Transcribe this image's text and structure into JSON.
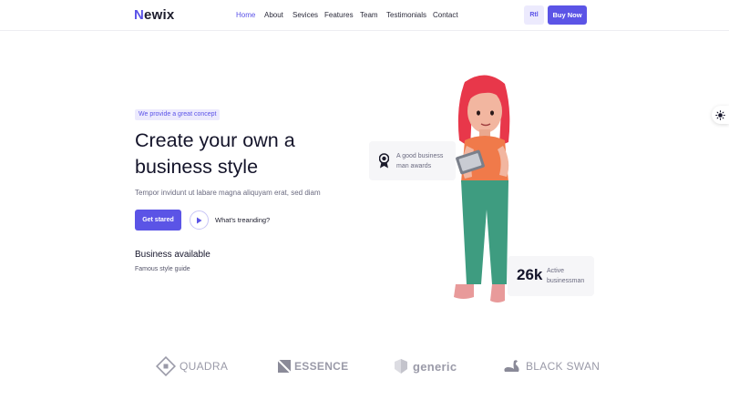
{
  "header": {
    "logo_initial": "N",
    "logo_rest": "ewix",
    "nav": [
      "Home",
      "About",
      "Sevices",
      "Features",
      "Team",
      "Testimonials",
      "Contact"
    ],
    "rtl_label": "Rtl",
    "buy_label": "Buy Now"
  },
  "hero": {
    "tagline": "We provide a great concept",
    "title_line1": "Create your own a",
    "title_line2": "business style",
    "subtitle": "Tempor invidunt ut labare magna aliquyam erat, sed diam",
    "cta_label": "Get stared",
    "trend_label": "What's treanding?",
    "biz_title": "Business available",
    "biz_subtitle": "Famous style guide"
  },
  "award_card": {
    "text": "A good business man awards"
  },
  "stat_card": {
    "number": "26k",
    "text": "Active businessman"
  },
  "brands": [
    "QUADRA",
    "ESSENCE",
    "generic",
    "BLACK SWAN"
  ],
  "colors": {
    "accent": "#5b54e6",
    "accent_light": "#eceafd",
    "text_dark": "#14142a",
    "text_muted": "#6b6b80",
    "card_bg": "#f6f6f8"
  }
}
